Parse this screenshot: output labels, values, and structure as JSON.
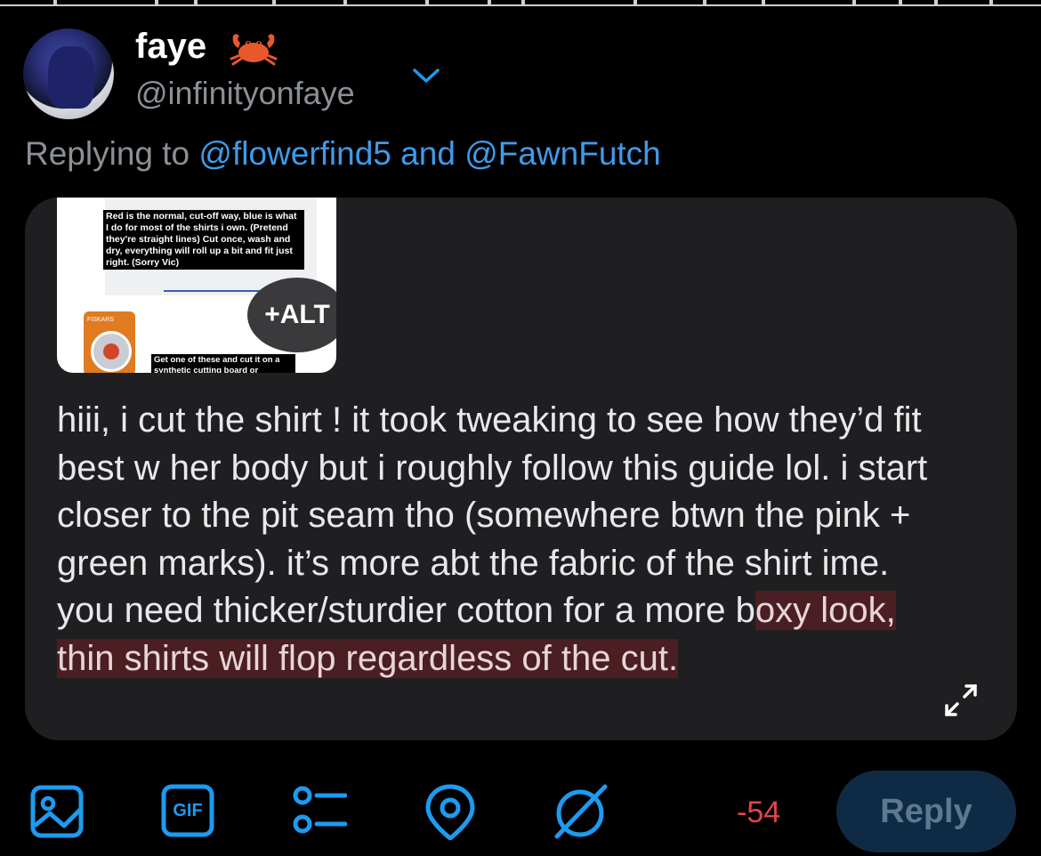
{
  "user": {
    "display_name": "faye",
    "emoji": "crab",
    "handle": "@infinityonfaye"
  },
  "replying": {
    "prefix": "Replying to",
    "mention1": "@flowerfind5",
    "joiner": "and",
    "mention2": "@FawnFutch"
  },
  "media": {
    "note_top": "Red is the normal, cut-off way, blue is what I do for most of the shirts i own. (Pretend they're straight lines) Cut once, wash and dry, everything will roll up a bit and fit just right. (Sorry Vic)",
    "note_bottom": "Get one of these and cut it on a synthetic cutting board or",
    "package_brand": "FISKARS",
    "alt_label": "+ALT"
  },
  "tweet": {
    "text_plain": "hiii, i cut the shirt ! it took tweaking to see how they’d fit best w her body but i roughly follow this guide lol. i start closer to the pit seam tho (somewhere btwn the pink + green marks). it’s more abt the fabric of the shirt ime. you need thicker/sturdier cotton for a more b",
    "text_highlight": "oxy look, thin shirts will flop regardless of the cut."
  },
  "toolbar": {
    "icons": [
      "image-icon",
      "gif-icon",
      "poll-icon",
      "location-icon",
      "circle-slash-icon"
    ],
    "gif_label": "GIF",
    "char_counter": "-54",
    "reply_label": "Reply"
  },
  "colors": {
    "background": "#000000",
    "card": "#1f1f21",
    "accent": "#1d9bf0",
    "highlight": "#4a1e23",
    "counter": "#e0454e"
  }
}
